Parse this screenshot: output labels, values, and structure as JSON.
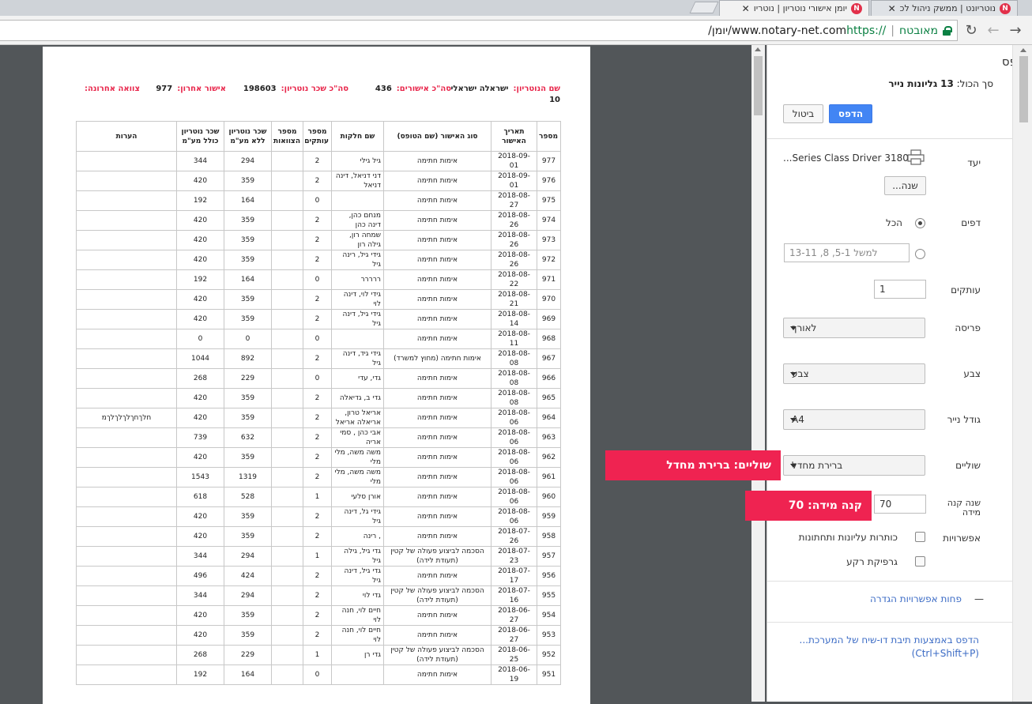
{
  "tabs": [
    {
      "title": "נוטריונט | ממשק ניהול לכ",
      "close": "✕",
      "favicon": "N"
    },
    {
      "title": "יומן אישורי נוטריון | נוטריו",
      "close": "✕",
      "favicon": "N"
    }
  ],
  "omnibox": {
    "secure_label": "מאובטח",
    "separator": "|",
    "url_scheme": "https://",
    "url_host": "www.notary-net.com",
    "url_path": "/יומן/"
  },
  "nav": {
    "back": "←",
    "forward": "→",
    "reload": "↻"
  },
  "sheet": {
    "notary_label": "שם הנוטריון:",
    "notary_value": "ישראלה ישראלי",
    "notary_suffix": "10",
    "total_approvals_label": "סה\"כ אישורים:",
    "total_approvals_value": "436",
    "total_fee_label": "סה\"כ שכר נוטריון:",
    "total_fee_value": "198603",
    "last_approval_label": "אישור אחרון:",
    "last_approval_value": "977",
    "team_label": "צוואה אחרונה:",
    "columns": [
      "מספר",
      "תאריך האישור",
      "סוג האישור (שם הטופס)",
      "שם חלקות",
      "מספר עותקים",
      "מספר הצוואות",
      "שכר נוטריון ללא מע\"מ",
      "שכר נוטריון כולל מע\"מ",
      "הערות"
    ],
    "rows": [
      [
        "977",
        "2018-09-01",
        "אימות חתימה",
        "גיל גילי",
        "2",
        "",
        "294",
        "344",
        ""
      ],
      [
        "976",
        "2018-09-01",
        "אימות חתימה",
        "דני דניאל, דינה דניאל",
        "2",
        "",
        "359",
        "420",
        ""
      ],
      [
        "975",
        "2018-08-27",
        "אימות חתימה",
        "",
        "0",
        "",
        "164",
        "192",
        ""
      ],
      [
        "974",
        "2018-08-26",
        "אימות חתימה",
        "מנחם כהן, דינה כהן",
        "2",
        "",
        "359",
        "420",
        ""
      ],
      [
        "973",
        "2018-08-26",
        "אימות חתימה",
        "שמחה רון, גילה רון",
        "2",
        "",
        "359",
        "420",
        ""
      ],
      [
        "972",
        "2018-08-26",
        "אימות חתימה",
        "גידי גיל, רינה גיל",
        "2",
        "",
        "359",
        "420",
        ""
      ],
      [
        "971",
        "2018-08-22",
        "אימות חתימה",
        "ררררר",
        "0",
        "",
        "164",
        "192",
        ""
      ],
      [
        "970",
        "2018-08-21",
        "אימות חתימה",
        "גידי לוי, דינה לוי",
        "2",
        "",
        "359",
        "420",
        ""
      ],
      [
        "969",
        "2018-08-14",
        "אימות חתימה",
        "גידי גיל, דינה גיל",
        "2",
        "",
        "359",
        "420",
        ""
      ],
      [
        "968",
        "2018-08-11",
        "אימות חתימה",
        "",
        "0",
        "",
        "0",
        "0",
        ""
      ],
      [
        "967",
        "2018-08-08",
        "אימות חתימה (מחוץ למשרד)",
        "גידי גיד, דינה גיל",
        "2",
        "",
        "892",
        "1044",
        ""
      ],
      [
        "966",
        "2018-08-08",
        "אימות חתימה",
        "גדי, עדי",
        "0",
        "",
        "229",
        "268",
        ""
      ],
      [
        "965",
        "2018-08-08",
        "אימות חתימה",
        "גדי ב, גדיאלה",
        "2",
        "",
        "359",
        "420",
        ""
      ],
      [
        "964",
        "2018-08-06",
        "אימות חתימה",
        "אריאל טרון, אריאלה אריאל",
        "2",
        "",
        "359",
        "420",
        "חלךחךלךלךלךמ"
      ],
      [
        "963",
        "2018-08-06",
        "אימות חתימה",
        "אבי כהן , סמי אריה",
        "2",
        "",
        "632",
        "739",
        ""
      ],
      [
        "962",
        "2018-08-06",
        "אימות חתימה",
        "משה משה, מלי מלי",
        "2",
        "",
        "359",
        "420",
        ""
      ],
      [
        "961",
        "2018-08-06",
        "אימות חתימה",
        "משה משה, מלי מלי",
        "2",
        "",
        "1319",
        "1543",
        ""
      ],
      [
        "960",
        "2018-08-06",
        "אימות חתימה",
        "אורן סלעי",
        "1",
        "",
        "528",
        "618",
        ""
      ],
      [
        "959",
        "2018-08-06",
        "אימות חתימה",
        "גידי גל, דינה גיל",
        "2",
        "",
        "359",
        "420",
        ""
      ],
      [
        "958",
        "2018-07-26",
        "אימות חתימה",
        ", רינה",
        "2",
        "",
        "359",
        "420",
        ""
      ],
      [
        "957",
        "2018-07-23",
        "הסכמה לביצוע פעולה של קטין (תעודת לידה)",
        "גדי גיל, גילה גיל",
        "1",
        "",
        "294",
        "344",
        ""
      ],
      [
        "956",
        "2018-07-17",
        "אימות חתימה",
        "גדי גיל, דינה גיל",
        "2",
        "",
        "424",
        "496",
        ""
      ],
      [
        "955",
        "2018-07-16",
        "הסכמה לביצוע פעולה של קטין (תעודת לידה)",
        "גדי לוי",
        "2",
        "",
        "294",
        "344",
        ""
      ],
      [
        "954",
        "2018-06-27",
        "אימות חתימה",
        "חיים לוי, חנה לוי",
        "2",
        "",
        "359",
        "420",
        ""
      ],
      [
        "953",
        "2018-06-27",
        "אימות חתימה",
        "חיים לוי, חנה לוי",
        "2",
        "",
        "359",
        "420",
        ""
      ],
      [
        "952",
        "2018-06-25",
        "הסכמה לביצוע פעולה של קטין (תעודת לידה)",
        "גדי רן",
        "1",
        "",
        "229",
        "268",
        ""
      ],
      [
        "951",
        "2018-06-19",
        "אימות חתימה",
        "",
        "0",
        "",
        "164",
        "192",
        ""
      ]
    ]
  },
  "print": {
    "title": "הדפס",
    "summary_prefix": "סך הכול:",
    "summary_count": "13",
    "summary_suffix": "גליונות נייר",
    "print_button": "הדפס",
    "cancel_button": "ביטול",
    "destination_label": "יעד",
    "destination_value": "3180 Series Class Driver...",
    "change_button": "שנה...",
    "pages_label": "דפים",
    "pages_all": "הכל",
    "pages_placeholder": "למשל 5-1, 8, 13-11",
    "copies_label": "עותקים",
    "copies_value": "1",
    "layout_label": "פריסה",
    "layout_value": "לאורך",
    "color_label": "צבע",
    "color_value": "צבע",
    "paper_label": "גודל נייר",
    "paper_value": "A4",
    "margins_label": "שוליים",
    "margins_value": "ברירת מחדל",
    "scale_label": "שנה קנה מידה",
    "scale_value": "70",
    "options_label": "אפשרויות",
    "option_headers": "כותרות עליונות ותחתונות",
    "option_background": "גרפיקת רקע",
    "fewer_options": "פחות אפשרויות הגדרה",
    "collapse_glyph": "—",
    "system_dialog": "הדפס באמצעות תיבת דו-שיח של המערכת...",
    "system_shortcut": "(Ctrl+Shift+P)"
  },
  "callouts": {
    "margins": "שוליים:  ברירת מחדל",
    "scale": "קנה מידה:  70"
  },
  "colors": {
    "accent": "#4285f4",
    "callout": "#ef2351",
    "header_label": "#e8254a",
    "secure": "#0b8043"
  }
}
